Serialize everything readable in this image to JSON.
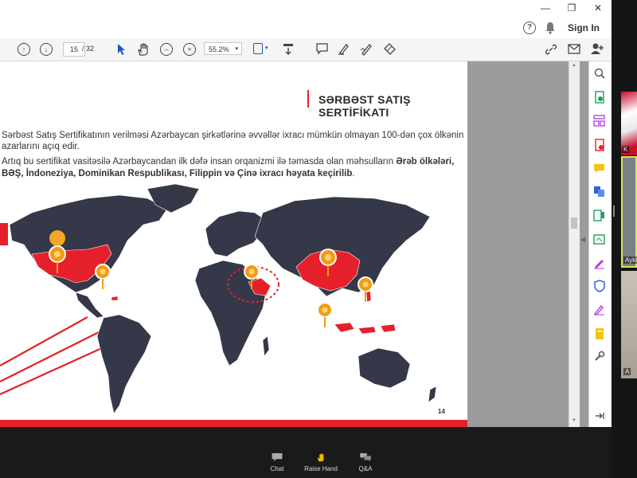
{
  "window": {
    "controls": [
      "—",
      "❐",
      "✕"
    ]
  },
  "header": {
    "help_icon": "help-icon",
    "bell_icon": "bell-icon",
    "sign_in_label": "Sign In"
  },
  "toolbar": {
    "current_page": "15",
    "page_separator": "/ 32",
    "zoom_value": "55.2%",
    "icons": [
      "prev-page-icon",
      "next-page-icon",
      "pointer-icon",
      "hand-icon",
      "zoom-out-icon",
      "zoom-in-icon",
      "fit-icon",
      "scroll-mode-icon",
      "comment-icon",
      "highlight-icon",
      "sign-icon",
      "stamp-icon",
      "share-link-icon",
      "email-icon",
      "add-user-icon"
    ]
  },
  "slide": {
    "title": "SƏRBƏST SATIŞ SERTİFİKATI",
    "paragraph1_line1": "Sərbəst Satış Sertifikatının verilməsi Azərbaycan şirkətlərinə əvvəllər ixracı mümkün olmayan 100-dən çox ölkənin",
    "paragraph1_line2": "azarlarını açıq edir.",
    "paragraph2_line1_normal": "Artıq bu sertifikat vasitəsilə Azərbaycandan ilk dəfə insan orqanizmi ilə təmasda olan məhsulların ",
    "paragraph2_line1_bold": "Ərəb ölkələri,",
    "paragraph2_line2": "BƏŞ, İndoneziya, Dominikan Respublikası, Filippin və Çinə ixracı həyata keçirilib",
    "paragraph2_line2_end": ".",
    "page_number": "14",
    "highlight_color": "#e5202a",
    "map_color": "#343849"
  },
  "right_panel": {
    "icons": [
      "zoom-search-icon",
      "export-pdf-icon",
      "organize-pages-icon",
      "create-pdf-icon",
      "comment-panel-icon",
      "combine-files-icon",
      "edit-pdf-icon",
      "scan-icon",
      "fill-sign-icon",
      "protect-icon",
      "pen-icon",
      "send-icon",
      "more-tools-icon",
      "collapse-panel-icon"
    ]
  },
  "meeting_bar": {
    "chat_label": "Chat",
    "raise_hand_label": "Raise Hand",
    "qa_label": "Q&A"
  },
  "side_strip": {
    "participant1_tag": "K",
    "participant2_tag": "Aykh",
    "participant3_tag": "A"
  }
}
